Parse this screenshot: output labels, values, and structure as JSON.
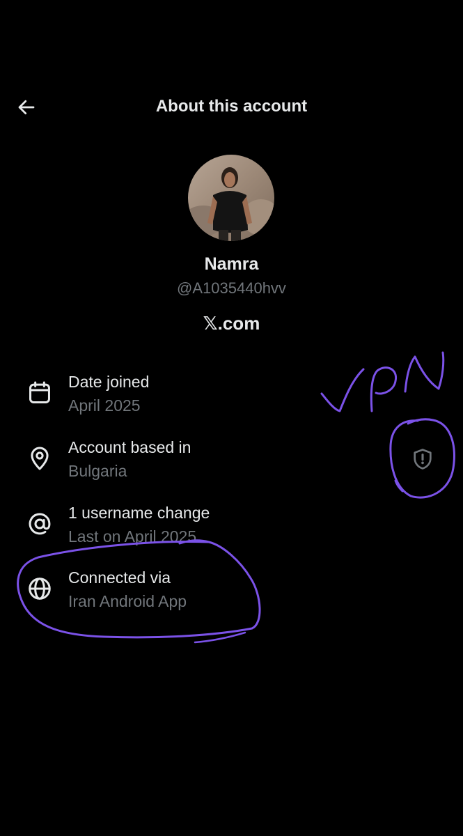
{
  "header": {
    "title": "About this account",
    "back_icon": "arrow-left-icon"
  },
  "profile": {
    "display_name": "Namra",
    "handle": "@A1035440hvv",
    "verified_via_x": ".com",
    "x_logo_glyph": "𝕏"
  },
  "info_rows": [
    {
      "icon": "calendar-icon",
      "label": "Date joined",
      "value": "April 2025"
    },
    {
      "icon": "location-pin-icon",
      "label": "Account based in",
      "value": "Bulgaria"
    },
    {
      "icon": "at-sign-icon",
      "label": "1 username change",
      "value": "Last on April 2025"
    },
    {
      "icon": "globe-icon",
      "label": "Connected via",
      "value": "Iran Android App"
    }
  ],
  "annotations": {
    "handwritten_text": "VPN",
    "ink_color": "#7b52e8"
  },
  "colors": {
    "background": "#000000",
    "primary_text": "#e7e9ea",
    "secondary_text": "#71767b",
    "annotation": "#7b52e8"
  }
}
